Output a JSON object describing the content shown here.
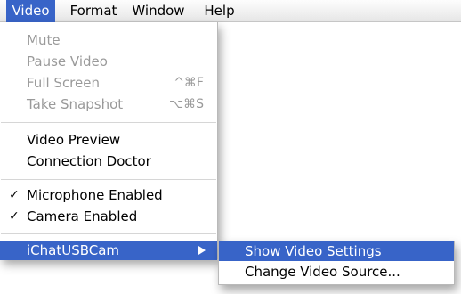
{
  "menubar": {
    "items": [
      {
        "label": "Video"
      },
      {
        "label": "Format"
      },
      {
        "label": "Window"
      },
      {
        "label": "Help"
      }
    ]
  },
  "video_menu": {
    "mute": {
      "label": "Mute"
    },
    "pause_video": {
      "label": "Pause Video"
    },
    "full_screen": {
      "label": "Full Screen",
      "shortcut": "^⌘F"
    },
    "take_snapshot": {
      "label": "Take Snapshot",
      "shortcut": "⌥⌘S"
    },
    "video_preview": {
      "label": "Video Preview"
    },
    "connection_doctor": {
      "label": "Connection Doctor"
    },
    "microphone_enabled": {
      "label": "Microphone Enabled",
      "check": "✓"
    },
    "camera_enabled": {
      "label": "Camera Enabled",
      "check": "✓"
    },
    "ichat_usbcam": {
      "label": "iChatUSBCam"
    }
  },
  "submenu": {
    "show_video_settings": {
      "label": "Show Video Settings"
    },
    "change_video_source": {
      "label": "Change Video Source..."
    }
  },
  "colors": {
    "highlight": "#3864c8",
    "disabled_text": "#9a9a9a"
  }
}
